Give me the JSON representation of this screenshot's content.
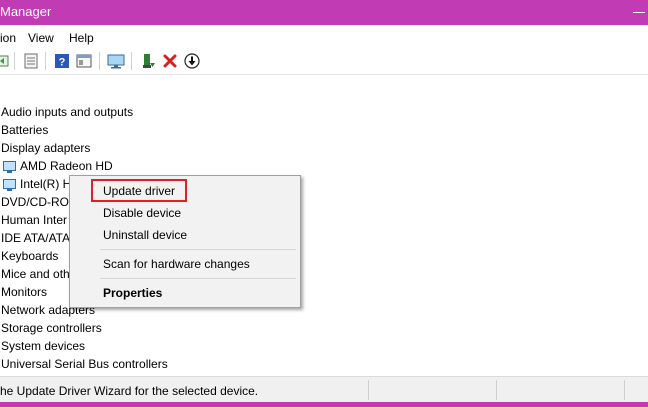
{
  "window": {
    "title": "Manager",
    "accent_color": "#c13cb4"
  },
  "menubar": {
    "items": [
      "ion",
      "View",
      "Help"
    ]
  },
  "toolbar": {
    "icons": [
      "back-icon",
      "properties-icon",
      "help-icon",
      "view-icon",
      "monitor-icon",
      "enable-device-icon",
      "uninstall-icon",
      "update-driver-icon"
    ]
  },
  "tree": {
    "items": [
      "Audio inputs and outputs",
      "Batteries",
      "Display adapters",
      "AMD Radeon HD",
      "Intel(R) H",
      "DVD/CD-ROI",
      "Human Inter",
      "IDE ATA/ATA",
      "Keyboards",
      "Mice and oth",
      "Monitors",
      "Network adapters",
      "Storage controllers",
      "System devices",
      "Universal Serial Bus controllers"
    ]
  },
  "context_menu": {
    "update_driver": "Update driver",
    "disable_device": "Disable device",
    "uninstall_device": "Uninstall device",
    "scan_hardware": "Scan for hardware changes",
    "properties": "Properties",
    "highlight_color": "#e01f26"
  },
  "statusbar": {
    "text": "he Update Driver Wizard for the selected device."
  }
}
